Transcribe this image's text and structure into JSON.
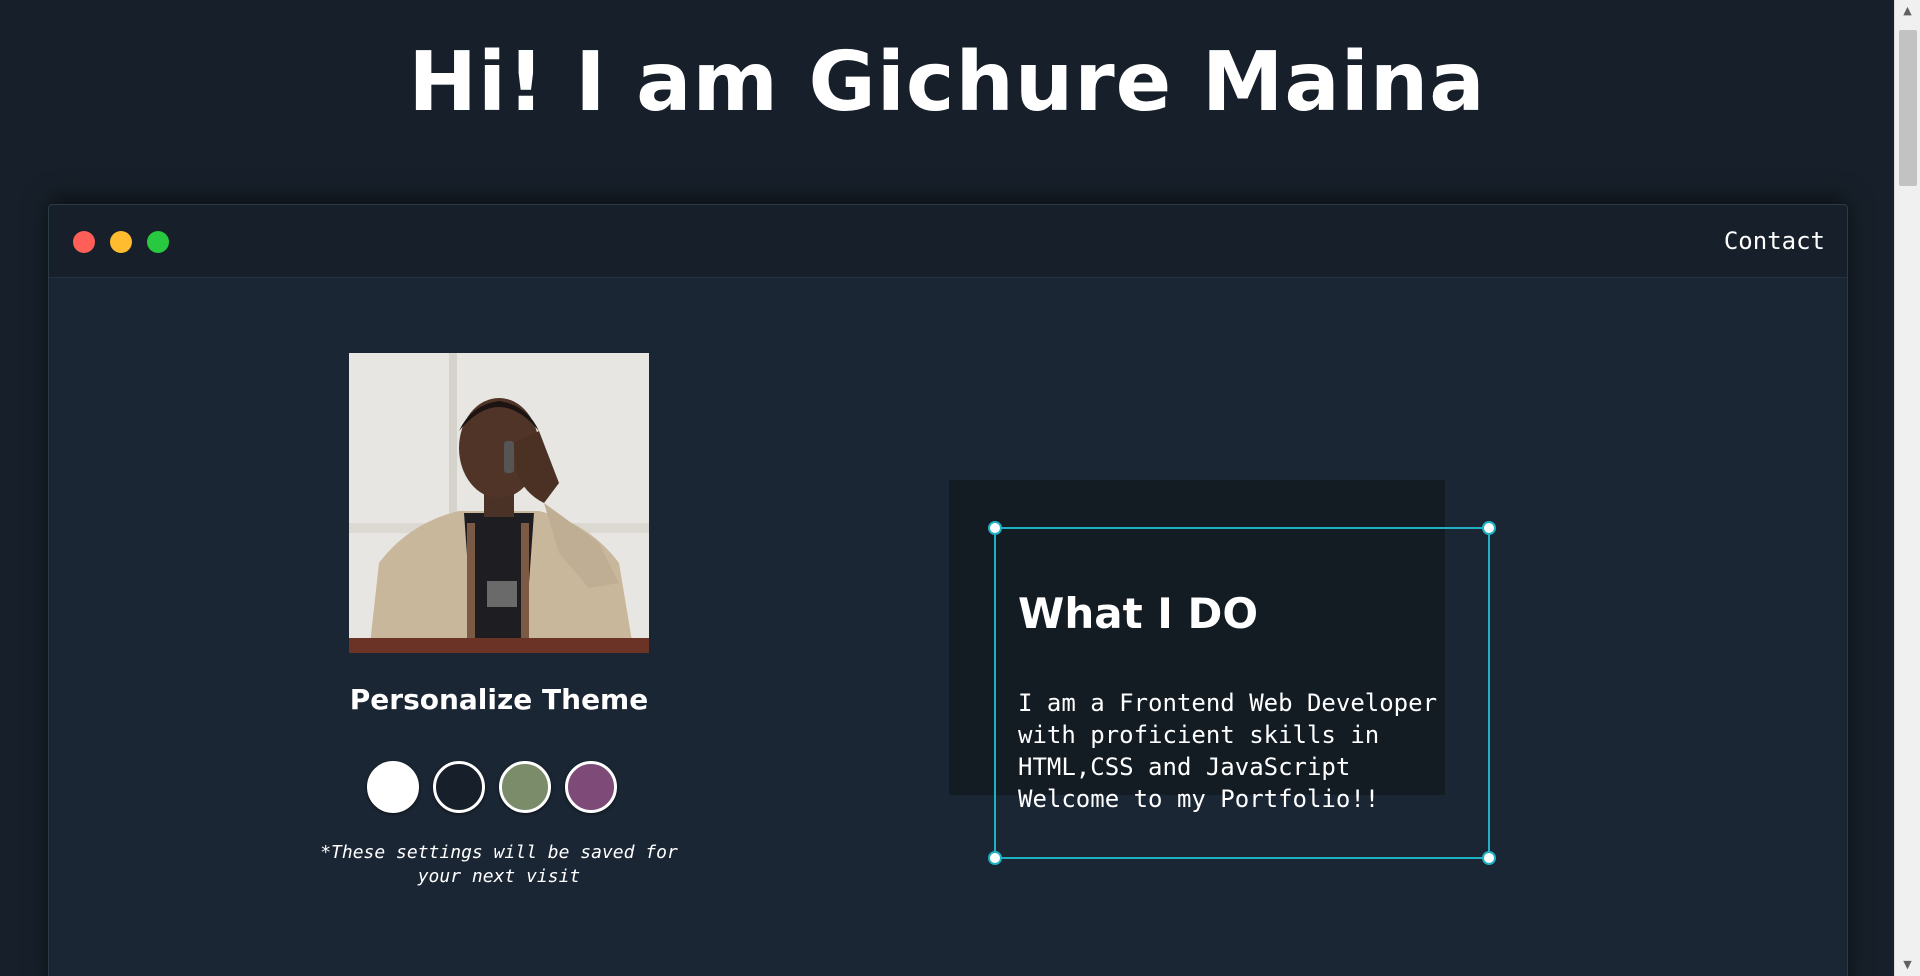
{
  "header": {
    "title": "Hi! I am Gichure Maina"
  },
  "window": {
    "controls": [
      "close",
      "minimize",
      "maximize"
    ],
    "control_colors": {
      "close": "#ff5f57",
      "minimize": "#febc2e",
      "maximize": "#28c840"
    },
    "nav": {
      "contact_label": "Contact"
    }
  },
  "profile": {
    "photo_icon": "profile-photo"
  },
  "theme": {
    "title": "Personalize Theme",
    "swatches": [
      {
        "name": "light",
        "color": "#ffffff"
      },
      {
        "name": "dark",
        "color": "#17202a"
      },
      {
        "name": "green",
        "color": "#7a8c6a"
      },
      {
        "name": "purple",
        "color": "#7e4a78"
      }
    ],
    "note": "*These settings will be saved for your next visit"
  },
  "about": {
    "title": "What I DO",
    "text": "I am a Frontend Web Developer\nwith proficient skills in\nHTML,CSS and JavaScript\nWelcome to my Portfolio!!"
  },
  "colors": {
    "background": "#17202a",
    "panel": "#1b2634",
    "accent": "#1fb0c3"
  }
}
